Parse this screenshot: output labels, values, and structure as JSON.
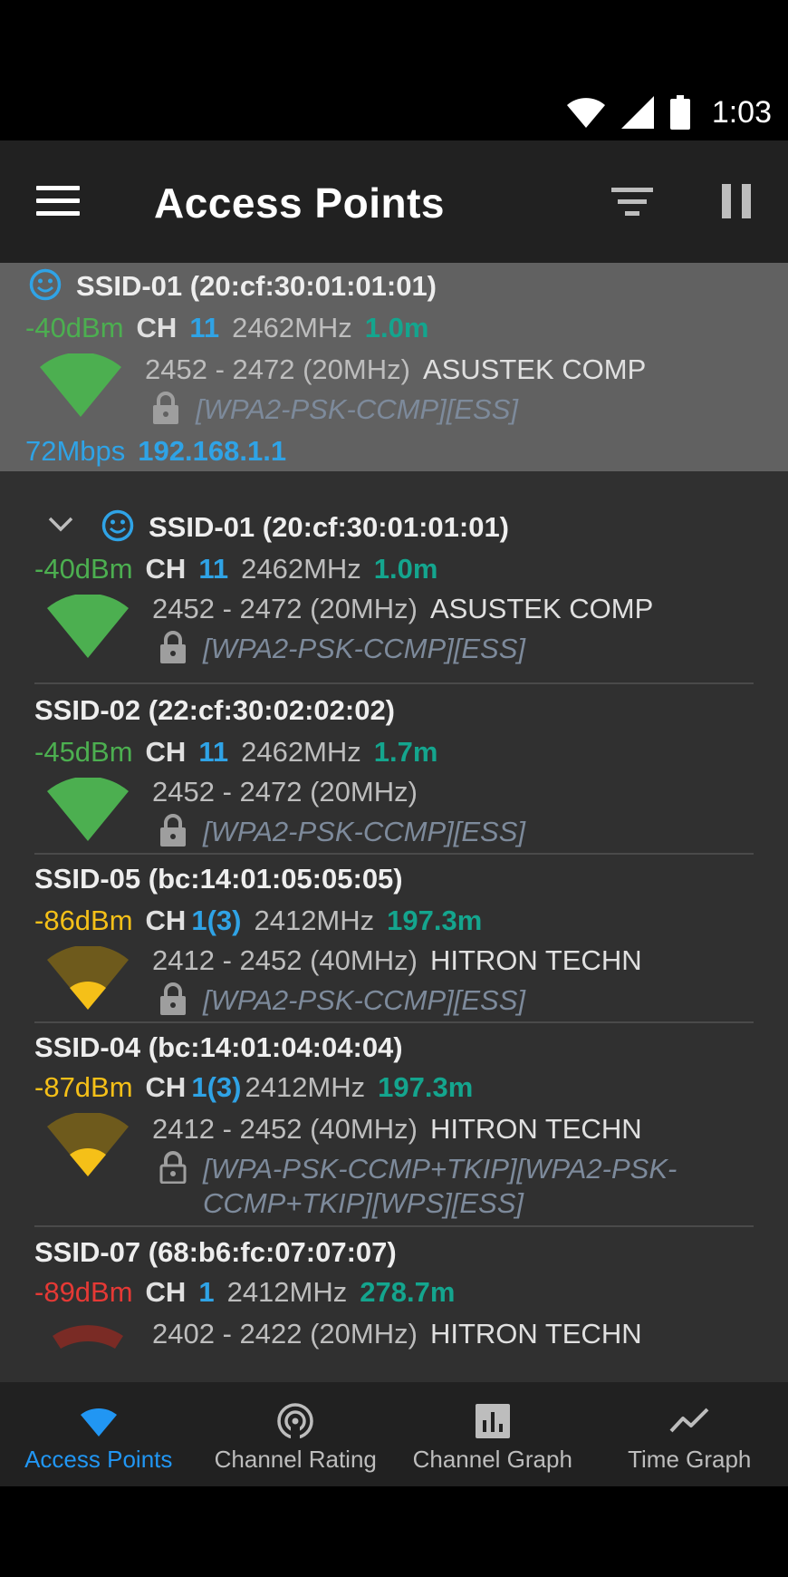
{
  "status_bar": {
    "time": "1:03"
  },
  "app_bar": {
    "title": "Access Points"
  },
  "connected": {
    "ssid": "SSID-01 (20:cf:30:01:01:01)",
    "level": "-40dBm",
    "ch_label": "CH",
    "channel": "11",
    "frequency": "2462MHz",
    "distance": "1.0m",
    "range": "2452 - 2472 (20MHz)",
    "vendor": "ASUSTEK COMP",
    "security": "[WPA2-PSK-CCMP][ESS]",
    "speed": "72Mbps",
    "ip": "192.168.1.1"
  },
  "access_points": [
    {
      "ssid": "SSID-01 (20:cf:30:01:01:01)",
      "level": "-40dBm",
      "ch_label": "CH",
      "channel": "11",
      "frequency": "2462MHz",
      "distance": "1.0m",
      "range": "2452 - 2472 (20MHz)",
      "vendor": "ASUSTEK COMP",
      "security": "[WPA2-PSK-CCMP][ESS]",
      "strength": "good"
    },
    {
      "ssid": "SSID-02 (22:cf:30:02:02:02)",
      "level": "-45dBm",
      "ch_label": "CH",
      "channel": "11",
      "frequency": "2462MHz",
      "distance": "1.7m",
      "range": "2452 - 2472 (20MHz)",
      "vendor": "",
      "security": "[WPA2-PSK-CCMP][ESS]",
      "strength": "good"
    },
    {
      "ssid": "SSID-05 (bc:14:01:05:05:05)",
      "level": "-86dBm",
      "ch_label": "CH",
      "channel": "1(3)",
      "frequency": "2412MHz",
      "distance": "197.3m",
      "range": "2412 - 2452 (40MHz)",
      "vendor": "HITRON TECHN",
      "security": "[WPA2-PSK-CCMP][ESS]",
      "strength": "weak"
    },
    {
      "ssid": "SSID-04 (bc:14:01:04:04:04)",
      "level": "-87dBm",
      "ch_label": "CH",
      "channel": "1(3)",
      "frequency": "2412MHz",
      "distance": "197.3m",
      "range": "2412 - 2452 (40MHz)",
      "vendor": "HITRON TECHN",
      "security_line1": "[WPA-PSK-CCMP+TKIP][WPA2-PSK-",
      "security_line2": "CCMP+TKIP][WPS][ESS]",
      "strength": "weak"
    },
    {
      "ssid": "SSID-07 (68:b6:fc:07:07:07)",
      "level": "-89dBm",
      "ch_label": "CH",
      "channel": "1",
      "frequency": "2412MHz",
      "distance": "278.7m",
      "range": "2402 - 2422 (20MHz)",
      "vendor": "HITRON TECHN",
      "strength": "bad"
    }
  ],
  "bottom_nav": [
    {
      "label": "Access Points",
      "icon": "wifi-icon",
      "active": true
    },
    {
      "label": "Channel Rating",
      "icon": "radar-icon",
      "active": false
    },
    {
      "label": "Channel Graph",
      "icon": "bar-chart-icon",
      "active": false
    },
    {
      "label": "Time Graph",
      "icon": "line-chart-icon",
      "active": false
    }
  ],
  "colors": {
    "good": "#4caf50",
    "weak": "#f5c018",
    "bad": "#e53935",
    "accent_blue": "#2fa3e6",
    "distance_teal": "#14a58e"
  }
}
